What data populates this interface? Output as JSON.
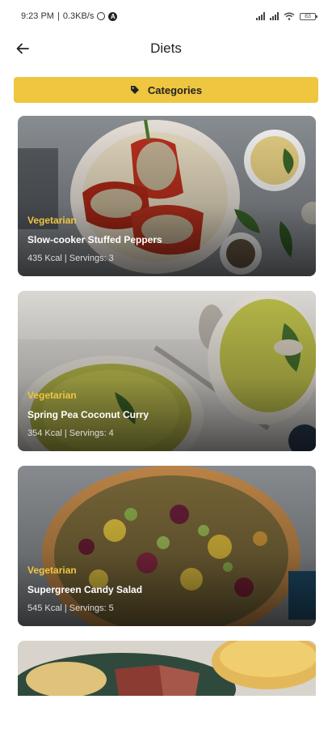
{
  "status": {
    "time": "9:23 PM",
    "speed": "0.3KB/s",
    "battery": "83"
  },
  "header": {
    "title": "Diets"
  },
  "categories_button": {
    "label": "Categories"
  },
  "recipes": [
    {
      "category": "Vegetarian",
      "name": "Slow-cooker Stuffed Peppers",
      "meta": "435 Kcal | Servings:  3"
    },
    {
      "category": "Vegetarian",
      "name": "Spring Pea Coconut Curry",
      "meta": "354 Kcal | Servings:  4"
    },
    {
      "category": "Vegetarian",
      "name": "Supergreen Candy Salad",
      "meta": "545 Kcal | Servings:  5"
    }
  ],
  "colors": {
    "accent": "#eec640"
  }
}
